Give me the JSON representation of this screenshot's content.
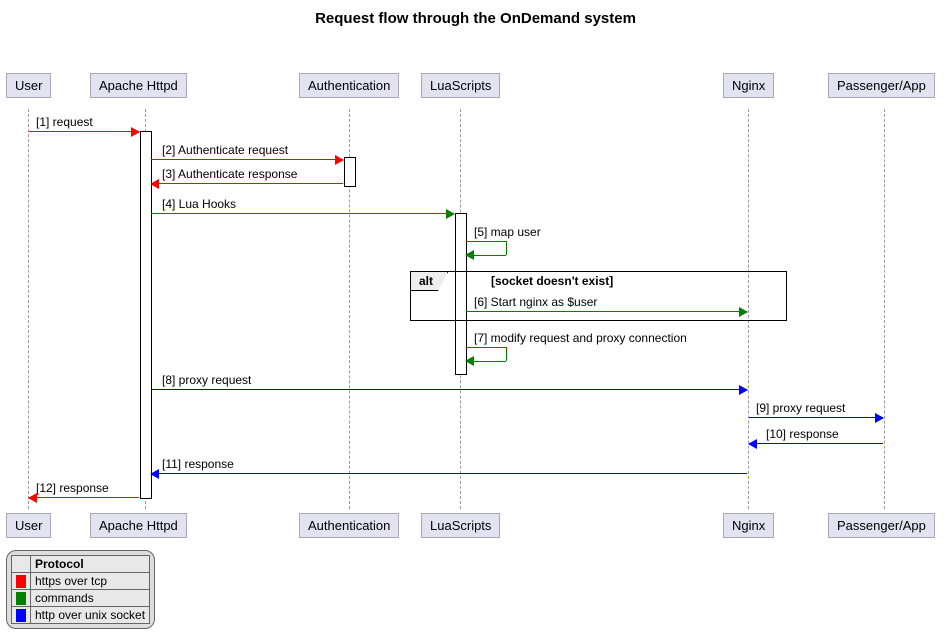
{
  "title": "Request flow through the OnDemand system",
  "participants": {
    "user": "User",
    "apache": "Apache Httpd",
    "auth": "Authentication",
    "lua": "LuaScripts",
    "nginx": "Nginx",
    "passenger": "Passenger/App"
  },
  "alt": {
    "label": "alt",
    "condition": "[socket doesn't exist]"
  },
  "messages": {
    "m1": "[1] request",
    "m2": "[2] Authenticate request",
    "m3": "[3] Authenticate response",
    "m4": "[4] Lua Hooks",
    "m5": "[5] map user",
    "m6": "[6] Start nginx as $user",
    "m7": "[7] modify request and proxy connection",
    "m8": "[8] proxy request",
    "m9": "[9] proxy request",
    "m10": "[10] response",
    "m11": "[11] response",
    "m12": "[12] response"
  },
  "legend": {
    "title": "Protocol",
    "rows": [
      {
        "color": "#ff0000",
        "label": "https over tcp"
      },
      {
        "color": "#008000",
        "label": "commands"
      },
      {
        "color": "#0000ff",
        "label": "http over unix socket"
      }
    ]
  },
  "colors": {
    "red": "#ff0000",
    "green": "#008000",
    "blue": "#0000ff"
  },
  "chart_data": {
    "type": "sequence-diagram",
    "participants": [
      "User",
      "Apache Httpd",
      "Authentication",
      "LuaScripts",
      "Nginx",
      "Passenger/App"
    ],
    "messages": [
      {
        "n": 1,
        "from": "User",
        "to": "Apache Httpd",
        "label": "request",
        "protocol": "https over tcp"
      },
      {
        "n": 2,
        "from": "Apache Httpd",
        "to": "Authentication",
        "label": "Authenticate request",
        "protocol": "https over tcp"
      },
      {
        "n": 3,
        "from": "Authentication",
        "to": "Apache Httpd",
        "label": "Authenticate response",
        "protocol": "https over tcp"
      },
      {
        "n": 4,
        "from": "Apache Httpd",
        "to": "LuaScripts",
        "label": "Lua Hooks",
        "protocol": "commands"
      },
      {
        "n": 5,
        "from": "LuaScripts",
        "to": "LuaScripts",
        "label": "map user",
        "protocol": "commands"
      },
      {
        "n": 6,
        "from": "LuaScripts",
        "to": "Nginx",
        "label": "Start nginx as $user",
        "protocol": "commands",
        "alt": "socket doesn't exist"
      },
      {
        "n": 7,
        "from": "LuaScripts",
        "to": "LuaScripts",
        "label": "modify request and proxy connection",
        "protocol": "commands"
      },
      {
        "n": 8,
        "from": "Apache Httpd",
        "to": "Nginx",
        "label": "proxy request",
        "protocol": "http over unix socket"
      },
      {
        "n": 9,
        "from": "Nginx",
        "to": "Passenger/App",
        "label": "proxy request",
        "protocol": "http over unix socket"
      },
      {
        "n": 10,
        "from": "Passenger/App",
        "to": "Nginx",
        "label": "response",
        "protocol": "http over unix socket"
      },
      {
        "n": 11,
        "from": "Nginx",
        "to": "Apache Httpd",
        "label": "response",
        "protocol": "http over unix socket"
      },
      {
        "n": 12,
        "from": "Apache Httpd",
        "to": "User",
        "label": "response",
        "protocol": "https over tcp"
      }
    ],
    "legend": {
      "https over tcp": "#ff0000",
      "commands": "#008000",
      "http over unix socket": "#0000ff"
    }
  }
}
